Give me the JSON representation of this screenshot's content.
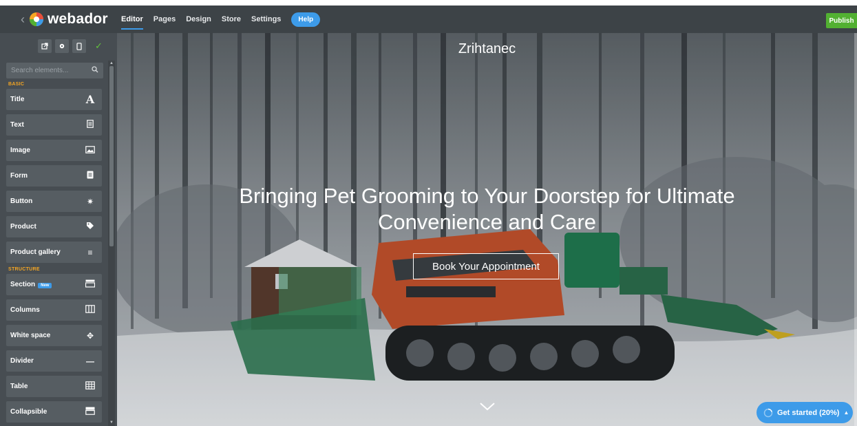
{
  "app": {
    "brand": "webador"
  },
  "nav": {
    "items": [
      "Editor",
      "Pages",
      "Design",
      "Store",
      "Settings"
    ],
    "help": "Help",
    "publish": "Publish"
  },
  "sidebar": {
    "search_placeholder": "Search elements...",
    "basic_label": "BASIC",
    "basic": [
      {
        "label": "Title",
        "icon": "title-icon"
      },
      {
        "label": "Text",
        "icon": "text-icon"
      },
      {
        "label": "Image",
        "icon": "image-icon"
      },
      {
        "label": "Form",
        "icon": "form-icon"
      },
      {
        "label": "Button",
        "icon": "button-icon"
      },
      {
        "label": "Product",
        "icon": "tag-icon"
      },
      {
        "label": "Product gallery",
        "icon": "list-icon"
      }
    ],
    "structure_label": "STRUCTURE",
    "structure": [
      {
        "label": "Section",
        "badge": "New",
        "icon": "section-icon"
      },
      {
        "label": "Columns",
        "icon": "columns-icon"
      },
      {
        "label": "White space",
        "icon": "white-space-icon"
      },
      {
        "label": "Divider",
        "icon": "divider-icon"
      },
      {
        "label": "Table",
        "icon": "table-icon"
      },
      {
        "label": "Collapsible",
        "icon": "collapsible-icon"
      }
    ]
  },
  "page": {
    "site_title": "Zrihtanec",
    "headline": "Bringing Pet Grooming to Your Doorstep for Ultimate Convenience and Care",
    "cta": "Book Your Appointment"
  },
  "onboarding": {
    "label": "Get started (20%)",
    "progress": 0.2
  },
  "colors": {
    "accent": "#3d9be9",
    "publish": "#52b032",
    "topbar": "#3d4347",
    "sidebar": "#474d52",
    "section_label": "#f5a623"
  }
}
